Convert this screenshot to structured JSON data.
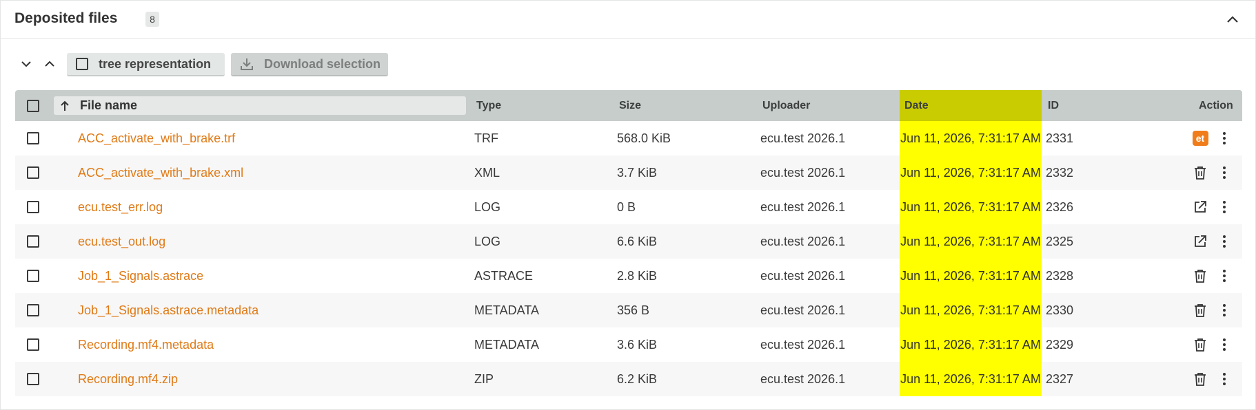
{
  "panel": {
    "title": "Deposited files",
    "count": "8"
  },
  "toolbar": {
    "tree_label": "tree representation",
    "download_label": "Download selection"
  },
  "table": {
    "headers": {
      "name": "File name",
      "type": "Type",
      "size": "Size",
      "uploader": "Uploader",
      "date": "Date",
      "id": "ID",
      "action": "Action"
    },
    "rows": [
      {
        "name": "ACC_activate_with_brake.trf",
        "type": "TRF",
        "size": "568.0 KiB",
        "uploader": "ecu.test 2026.1",
        "date": "Jun 11, 2026, 7:31:17 AM",
        "id": "2331",
        "action_icon": "ecu-test-badge-icon",
        "badge": "et"
      },
      {
        "name": "ACC_activate_with_brake.xml",
        "type": "XML",
        "size": "3.7 KiB",
        "uploader": "ecu.test 2026.1",
        "date": "Jun 11, 2026, 7:31:17 AM",
        "id": "2332",
        "action_icon": "trash-icon"
      },
      {
        "name": "ecu.test_err.log",
        "type": "LOG",
        "size": "0 B",
        "uploader": "ecu.test 2026.1",
        "date": "Jun 11, 2026, 7:31:17 AM",
        "id": "2326",
        "action_icon": "open-external-icon"
      },
      {
        "name": "ecu.test_out.log",
        "type": "LOG",
        "size": "6.6 KiB",
        "uploader": "ecu.test 2026.1",
        "date": "Jun 11, 2026, 7:31:17 AM",
        "id": "2325",
        "action_icon": "open-external-icon"
      },
      {
        "name": "Job_1_Signals.astrace",
        "type": "ASTRACE",
        "size": "2.8 KiB",
        "uploader": "ecu.test 2026.1",
        "date": "Jun 11, 2026, 7:31:17 AM",
        "id": "2328",
        "action_icon": "trash-icon"
      },
      {
        "name": "Job_1_Signals.astrace.metadata",
        "type": "METADATA",
        "size": "356 B",
        "uploader": "ecu.test 2026.1",
        "date": "Jun 11, 2026, 7:31:17 AM",
        "id": "2330",
        "action_icon": "trash-icon"
      },
      {
        "name": "Recording.mf4.metadata",
        "type": "METADATA",
        "size": "3.6 KiB",
        "uploader": "ecu.test 2026.1",
        "date": "Jun 11, 2026, 7:31:17 AM",
        "id": "2329",
        "action_icon": "trash-icon"
      },
      {
        "name": "Recording.mf4.zip",
        "type": "ZIP",
        "size": "6.2 KiB",
        "uploader": "ecu.test 2026.1",
        "date": "Jun 11, 2026, 7:31:17 AM",
        "id": "2327",
        "action_icon": "trash-icon"
      }
    ]
  },
  "colors": {
    "accent": "#e07a16",
    "date_highlight": "#ffff00",
    "date_header_highlight": "#c8cc00",
    "header_bg": "#c6cdca",
    "badge": "#f07d1a"
  }
}
